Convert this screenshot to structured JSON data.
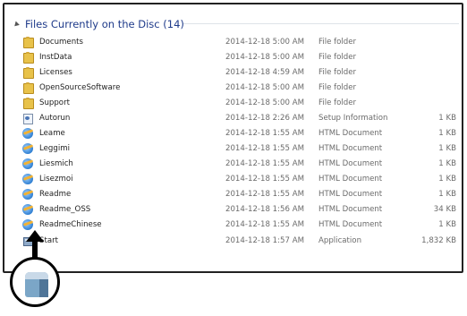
{
  "group": {
    "title": "Files Currently on the Disc (14)"
  },
  "files": [
    {
      "name": "Documents",
      "date": "2014-12-18 5:00 AM",
      "type": "File folder",
      "size": "",
      "icon": "folder-icon"
    },
    {
      "name": "InstData",
      "date": "2014-12-18 5:00 AM",
      "type": "File folder",
      "size": "",
      "icon": "folder-icon"
    },
    {
      "name": "Licenses",
      "date": "2014-12-18 4:59 AM",
      "type": "File folder",
      "size": "",
      "icon": "folder-icon"
    },
    {
      "name": "OpenSourceSoftware",
      "date": "2014-12-18 5:00 AM",
      "type": "File folder",
      "size": "",
      "icon": "folder-icon"
    },
    {
      "name": "Support",
      "date": "2014-12-18 5:00 AM",
      "type": "File folder",
      "size": "",
      "icon": "folder-icon"
    },
    {
      "name": "Autorun",
      "date": "2014-12-18 2:26 AM",
      "type": "Setup Information",
      "size": "1 KB",
      "icon": "setup-information-icon"
    },
    {
      "name": "Leame",
      "date": "2014-12-18 1:55 AM",
      "type": "HTML Document",
      "size": "1 KB",
      "icon": "html-document-icon"
    },
    {
      "name": "Leggimi",
      "date": "2014-12-18 1:55 AM",
      "type": "HTML Document",
      "size": "1 KB",
      "icon": "html-document-icon"
    },
    {
      "name": "Liesmich",
      "date": "2014-12-18 1:55 AM",
      "type": "HTML Document",
      "size": "1 KB",
      "icon": "html-document-icon"
    },
    {
      "name": "Lisezmoi",
      "date": "2014-12-18 1:55 AM",
      "type": "HTML Document",
      "size": "1 KB",
      "icon": "html-document-icon"
    },
    {
      "name": "Readme",
      "date": "2014-12-18 1:55 AM",
      "type": "HTML Document",
      "size": "1 KB",
      "icon": "html-document-icon"
    },
    {
      "name": "Readme_OSS",
      "date": "2014-12-18 1:56 AM",
      "type": "HTML Document",
      "size": "34 KB",
      "icon": "html-document-icon"
    },
    {
      "name": "ReadmeChinese",
      "date": "2014-12-18 1:55 AM",
      "type": "HTML Document",
      "size": "1 KB",
      "icon": "html-document-icon"
    },
    {
      "name": "Start",
      "date": "2014-12-18 1:57 AM",
      "type": "Application",
      "size": "1,832 KB",
      "icon": "application-icon"
    }
  ],
  "callout": {
    "icon": "start-application-icon"
  }
}
